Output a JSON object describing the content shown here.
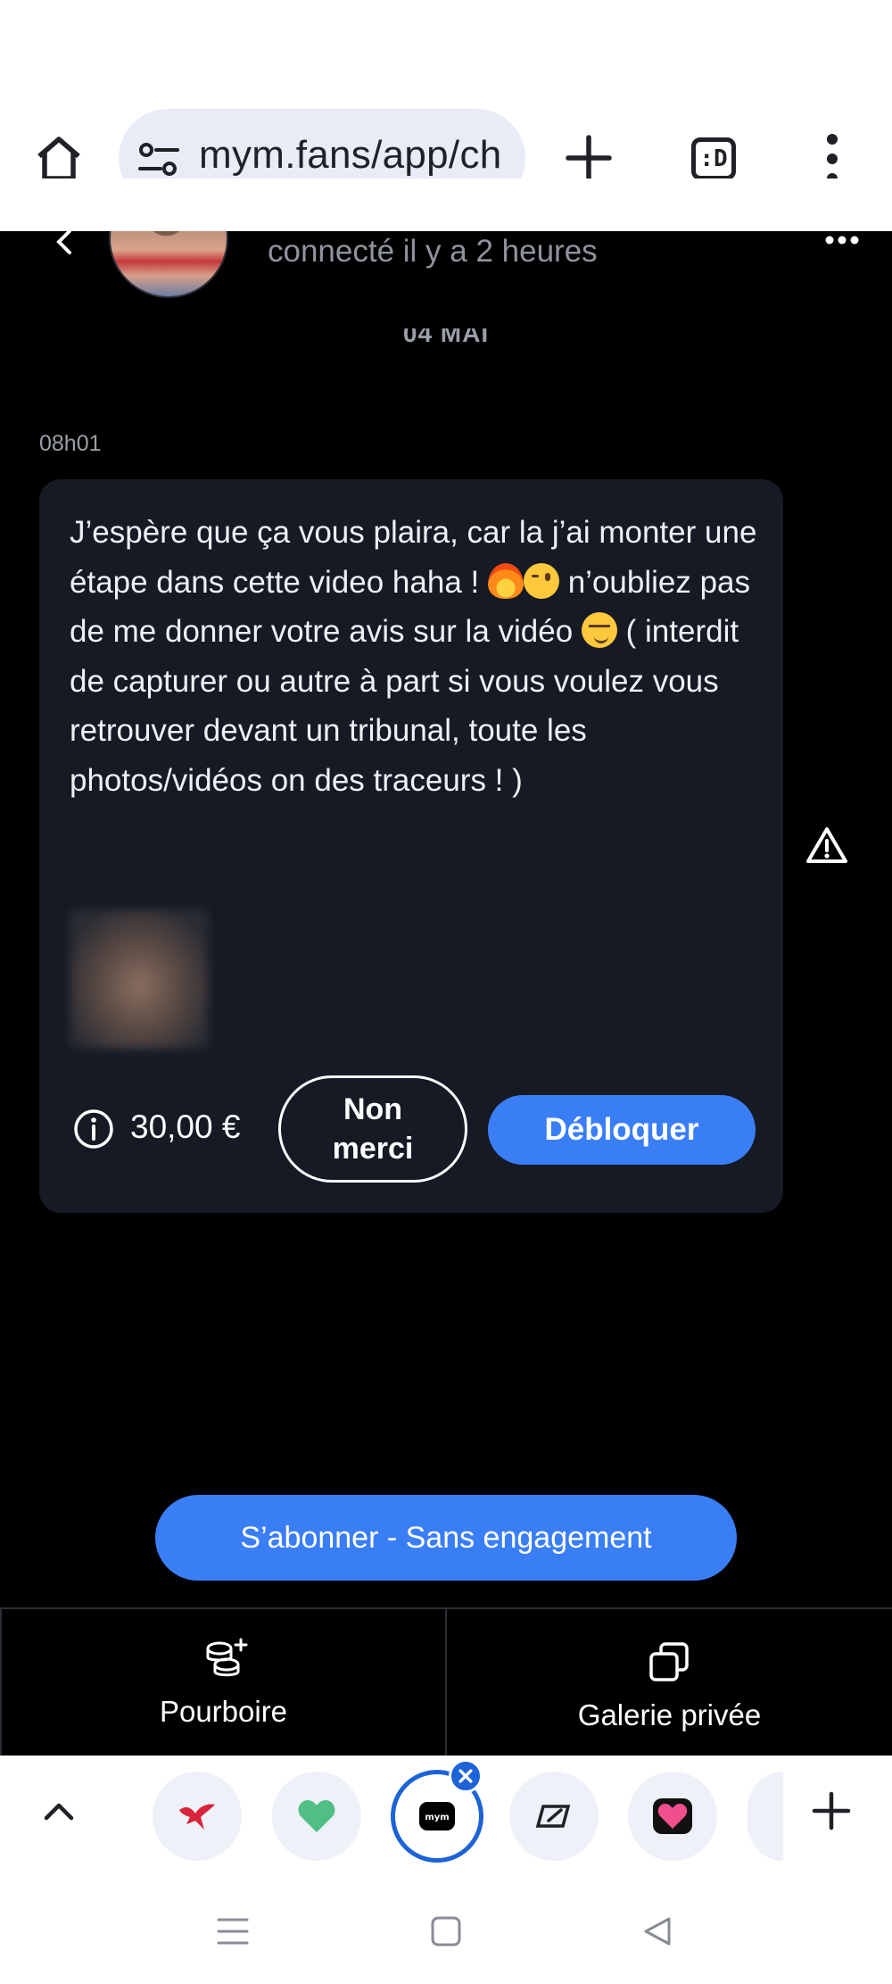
{
  "browser": {
    "url": "mym.fans/app/ch",
    "tab_count": ":D"
  },
  "chat": {
    "presence": "connecté il y a 2 heures",
    "date_separator": "04 MAI"
  },
  "message": {
    "time": "08h01",
    "text_parts": [
      "J’espère que ça vous plaira, car la j’ai monter une étape dans cette video haha ! ",
      "n’oubliez pas de me donner votre avis sur la vidéo ",
      " ( interdit de capturer ou autre à part si vous voulez vous retrouver devant un tribunal, toute les photos/vidéos on des traceurs ! )"
    ],
    "price": "30,00 €",
    "decline_label": "Non merci",
    "unlock_label": "Débloquer"
  },
  "actions": {
    "subscribe_label": "S’abonner - Sans engagement",
    "tip_label": "Pourboire",
    "gallery_label": "Galerie privée"
  },
  "icons": {
    "home": "home-icon",
    "site_settings": "tune-icon",
    "new_tab": "plus-icon",
    "menu": "kebab-menu-icon",
    "back": "chevron-left-icon",
    "more": "more-horizontal-icon",
    "info": "info-icon",
    "report": "warning-icon",
    "tip": "coins-plus-icon",
    "gallery": "copy-icon"
  },
  "colors": {
    "accent": "#3a7ef6",
    "background": "#000000",
    "card": "#151a24",
    "active_tab_ring": "#1b63d6"
  }
}
